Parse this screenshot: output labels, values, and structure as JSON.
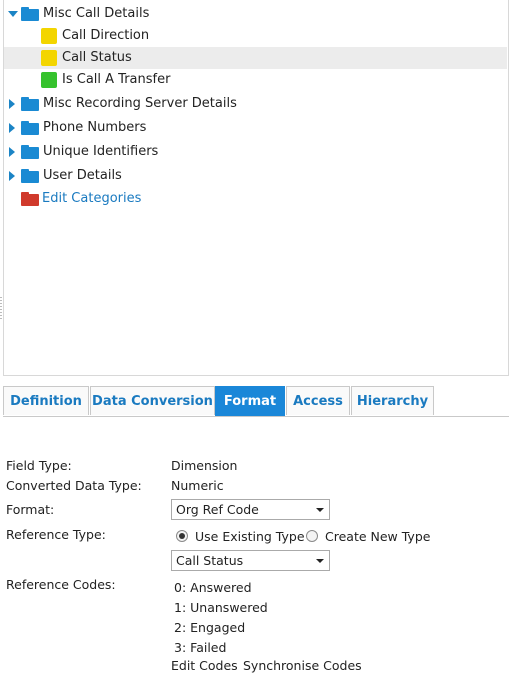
{
  "tree": {
    "items": [
      {
        "label": "Misc Call Details"
      },
      {
        "label": "Call Direction"
      },
      {
        "label": "Call Status"
      },
      {
        "label": "Is Call A Transfer"
      },
      {
        "label": "Misc Recording Server Details"
      },
      {
        "label": "Phone Numbers"
      },
      {
        "label": "Unique Identifiers"
      },
      {
        "label": "User Details"
      },
      {
        "label": "Edit Categories"
      }
    ],
    "colors": {
      "folder": "#1a8ad3",
      "edit_folder": "#d03a2c",
      "yellow": "#f3d500",
      "green": "#35c22d",
      "selected_bg": "#ececec"
    }
  },
  "tabs": {
    "definition": "Definition",
    "data_conversion": "Data Conversion",
    "format": "Format",
    "access": "Access",
    "hierarchy": "Hierarchy",
    "active": "Format",
    "accent": "#1a87d8"
  },
  "form": {
    "field_type_label": "Field Type:",
    "field_type_value": "Dimension",
    "converted_label": "Converted Data Type:",
    "converted_value": "Numeric",
    "format_label": "Format:",
    "format_value": "Org Ref Code",
    "reference_type_label": "Reference Type:",
    "use_existing": "Use Existing Type",
    "create_new": "Create New Type",
    "reference_select_value": "Call Status",
    "reference_codes_label": "Reference Codes:",
    "codes": [
      {
        "num": "0:",
        "text": "Answered"
      },
      {
        "num": "1:",
        "text": "Unanswered"
      },
      {
        "num": "2:",
        "text": "Engaged"
      },
      {
        "num": "3:",
        "text": "Failed"
      }
    ],
    "edit_codes": "Edit Codes",
    "synchronise_codes": "Synchronise Codes"
  }
}
